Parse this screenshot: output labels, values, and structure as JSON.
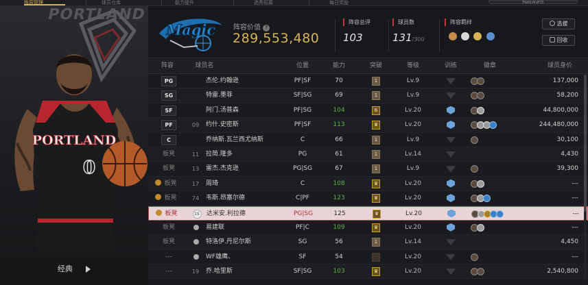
{
  "top_tabs": [
    {
      "label": "阵容管理",
      "active": true
    },
    {
      "label": "球员仓库",
      "active": false
    },
    {
      "label": "能力提升",
      "active": false
    },
    {
      "label": "选秀招募",
      "active": false
    },
    {
      "label": "每日奖励",
      "active": false
    }
  ],
  "top_pill": "ffe阵容对比",
  "left_panel": {
    "team_word": "PORTLAND",
    "jersey_text": "PORTLAND",
    "jersey_number": "0",
    "style_label": "经典"
  },
  "header": {
    "lineup_value_label": "阵容价值",
    "help_mark": "?",
    "lineup_value": "289,553,480",
    "stats": [
      {
        "tag": "阵容总评",
        "value": "103",
        "suffix": ""
      },
      {
        "tag": "球员数",
        "value": "131",
        "suffix": "/300"
      },
      {
        "tag": "阵容羁绊",
        "value": "",
        "suffix": ""
      }
    ],
    "buttons": {
      "select": "选拔",
      "recycle": "回收"
    },
    "colors": {
      "accent": "#d9b45a",
      "team_blue": "#1e6fb0"
    }
  },
  "table": {
    "headers": [
      "阵容",
      "球员名",
      "位置",
      "能力",
      "突破",
      "等级",
      "训练",
      "徽章",
      "球员身价"
    ],
    "rows": [
      {
        "role": "PG",
        "num": "",
        "name": "杰伦.约翰逊",
        "pos": "PF|SF",
        "ability": "70",
        "break": "1",
        "level": "Lv.9",
        "price": "137,000"
      },
      {
        "role": "SG",
        "num": "",
        "name": "特雷.墨菲",
        "pos": "SF|SG",
        "ability": "69",
        "break": "1",
        "level": "Lv.9",
        "price": "58,200"
      },
      {
        "role": "SF",
        "num": "",
        "name": "阿门.汤普森",
        "pos": "PF|SG",
        "ability": "104",
        "break": "6",
        "level": "Lv.20",
        "price": "44,800,000"
      },
      {
        "role": "PF",
        "num": "09",
        "name": "约什.史密斯",
        "pos": "PF|SF",
        "ability": "113",
        "break": "",
        "level": "Lv.20",
        "price": "244,480,000"
      },
      {
        "role": "C",
        "num": "",
        "name": "乔纳斯.瓦兰西尤纳斯",
        "pos": "C",
        "ability": "66",
        "break": "1",
        "level": "Lv.9",
        "price": "30,100"
      },
      {
        "role": "板凳",
        "num": "11",
        "name": "拉简.隆多",
        "pos": "PG",
        "ability": "61",
        "break": "1",
        "level": "Lv.14",
        "price": "4,430"
      },
      {
        "role": "板凳",
        "num": "13",
        "name": "雷杰.杰克逊",
        "pos": "PG|SG",
        "ability": "67",
        "break": "1",
        "level": "Lv.9",
        "price": "39,300"
      },
      {
        "role": "板凳",
        "num": "17",
        "name": "周琦",
        "pos": "C",
        "ability": "108",
        "break": "",
        "level": "Lv.20",
        "price": "---"
      },
      {
        "role": "板凳",
        "num": "74",
        "name": "韦斯.昂塞尔德",
        "pos": "C|PF",
        "ability": "123",
        "break": "",
        "level": "Lv.20",
        "price": "---"
      },
      {
        "role": "板凳",
        "num": "15",
        "name": "达米安.利拉德",
        "pos": "PG|SG",
        "ability": "125",
        "break": "",
        "level": "Lv.20",
        "price": "---"
      },
      {
        "role": "板凳",
        "num": "",
        "name": "易建联",
        "pos": "PF|C",
        "ability": "109",
        "break": "",
        "level": "Lv.20",
        "price": "---"
      },
      {
        "role": "板凳",
        "num": "",
        "name": "特洛伊.丹尼尔斯",
        "pos": "SG",
        "ability": "56",
        "break": "1",
        "level": "Lv.14",
        "price": "4,450"
      },
      {
        "role": "---",
        "num": "",
        "name": "WF雄鹰、",
        "pos": "SF",
        "ability": "54",
        "break": "",
        "level": "Lv.20",
        "price": "---"
      },
      {
        "role": "---",
        "num": "19",
        "name": "乔.哈里斯",
        "pos": "SF|SG",
        "ability": "103",
        "break": "",
        "level": "Lv.20",
        "price": "2,540,800"
      }
    ]
  }
}
